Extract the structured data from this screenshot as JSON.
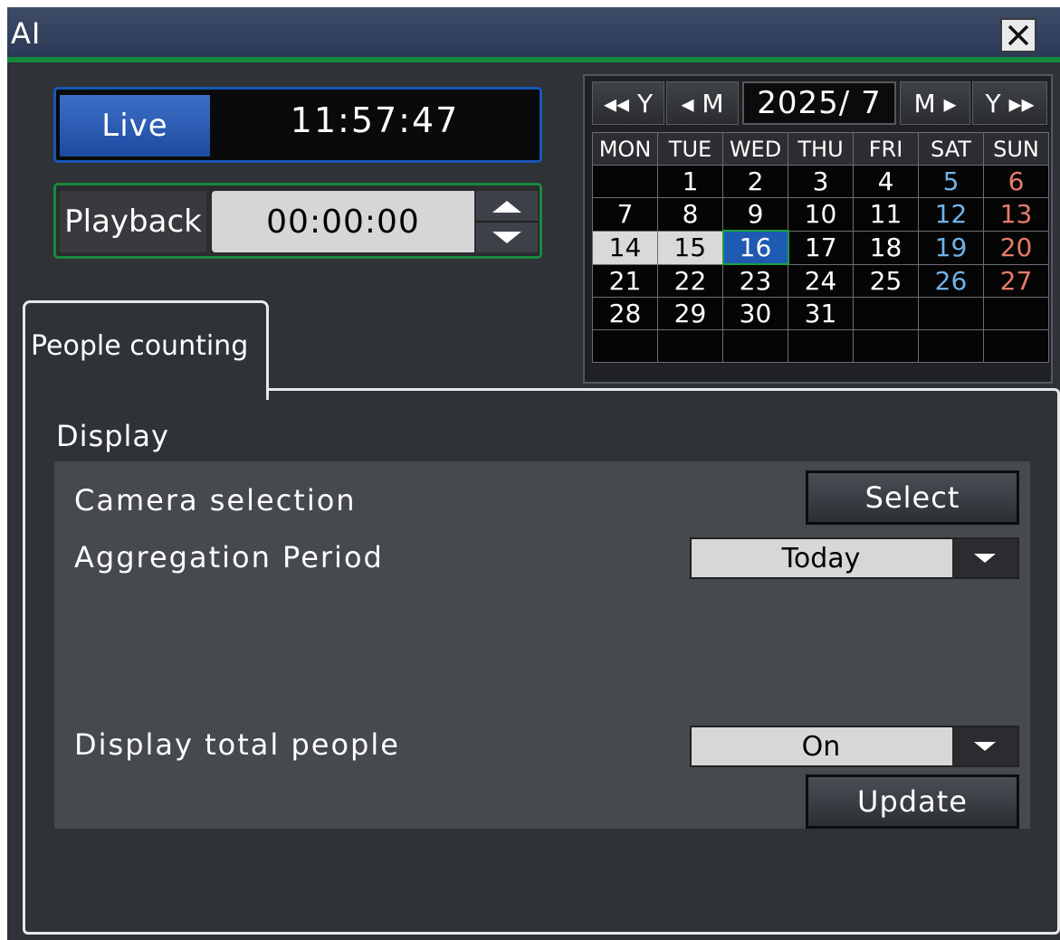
{
  "window": {
    "title": "AI"
  },
  "live": {
    "label": "Live",
    "time": "11:57:47"
  },
  "playback": {
    "label": "Playback",
    "time": "00:00:00"
  },
  "calendar": {
    "nav": {
      "prev_year": "◂◂ Y",
      "prev_month": "◂ M",
      "next_month": "M ▸",
      "next_year": "Y ▸▸"
    },
    "month_label": "2025/ 7",
    "weekdays": [
      "MON",
      "TUE",
      "WED",
      "THU",
      "FRI",
      "SAT",
      "SUN"
    ],
    "weeks": [
      [
        "",
        "1",
        "2",
        "3",
        "4",
        "5",
        "6"
      ],
      [
        "7",
        "8",
        "9",
        "10",
        "11",
        "12",
        "13"
      ],
      [
        "14",
        "15",
        "16",
        "17",
        "18",
        "19",
        "20"
      ],
      [
        "21",
        "22",
        "23",
        "24",
        "25",
        "26",
        "27"
      ],
      [
        "28",
        "29",
        "30",
        "31",
        "",
        "",
        ""
      ],
      [
        "",
        "",
        "",
        "",
        "",
        "",
        ""
      ]
    ],
    "selected_day": "16",
    "highlighted_days": [
      "14",
      "15"
    ]
  },
  "tabs": [
    {
      "label": "People counting"
    }
  ],
  "display_section": {
    "title": "Display",
    "camera_selection": {
      "label": "Camera selection",
      "button": "Select"
    },
    "aggregation_period": {
      "label": "Aggregation Period",
      "value": "Today"
    },
    "display_total_people": {
      "label": "Display total people",
      "value": "On"
    },
    "update_button": "Update"
  },
  "colors": {
    "live_accent": "#1a56b8",
    "playback_accent": "#188a3c",
    "saturday": "#6fb3ea",
    "sunday": "#e77b6b"
  }
}
